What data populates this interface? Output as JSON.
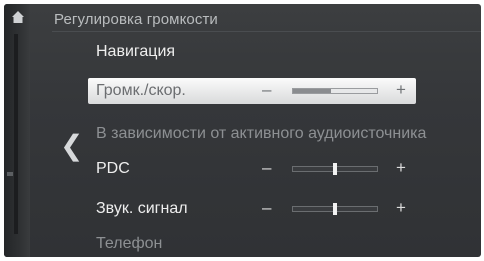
{
  "header": {
    "title": "Регулировка громкости"
  },
  "nav": {
    "back_glyph": "❮",
    "home_icon": "home-icon"
  },
  "rows": [
    {
      "label": "Навигация"
    },
    {
      "label": "Громк./скор.",
      "minus": "–",
      "plus": "+",
      "level": 0.45
    },
    {
      "label": "В зависимости от активного аудиоисточника"
    },
    {
      "label": "PDC",
      "minus": "–",
      "plus": "+",
      "level": 0.5
    },
    {
      "label": "Звук. сигнал",
      "minus": "–",
      "plus": "+",
      "level": 0.5
    },
    {
      "label": "Телефон"
    }
  ],
  "colors": {
    "background": "#35373a",
    "selected_row": "#ececec",
    "text": "#eeeeee",
    "dim_text": "#8d9093"
  }
}
